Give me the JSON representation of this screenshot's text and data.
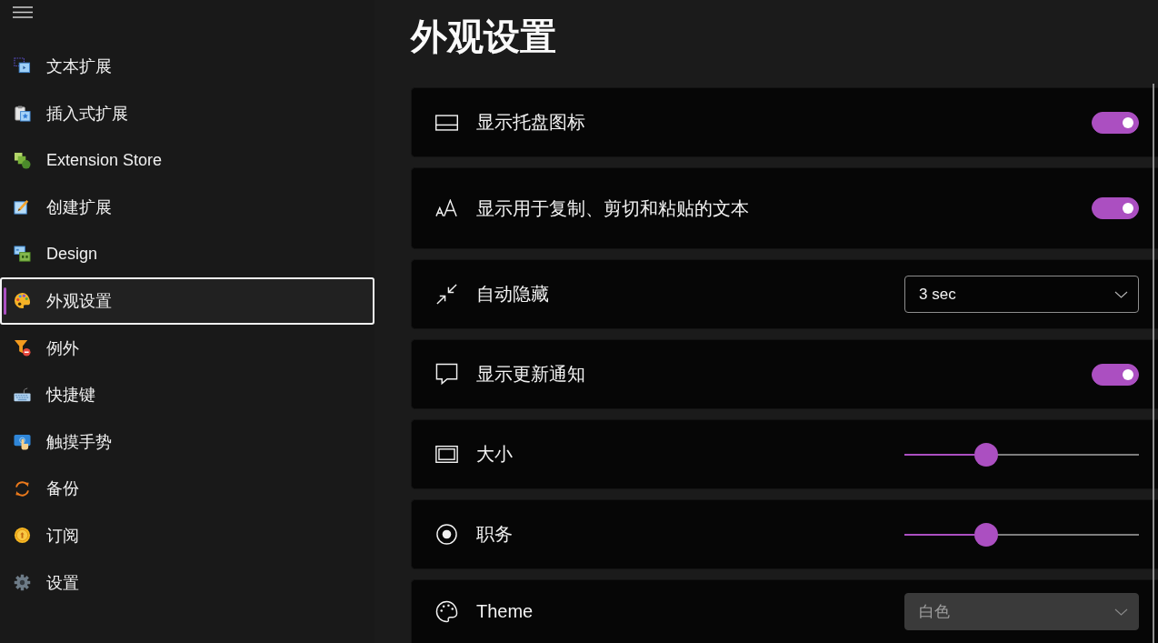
{
  "sidebar": {
    "items": [
      {
        "label": "文本扩展",
        "selected": false
      },
      {
        "label": "插入式扩展",
        "selected": false
      },
      {
        "label": "Extension Store",
        "selected": false
      },
      {
        "label": "创建扩展",
        "selected": false
      },
      {
        "label": "Design",
        "selected": false
      },
      {
        "label": "外观设置",
        "selected": true
      },
      {
        "label": "例外",
        "selected": false
      },
      {
        "label": "快捷键",
        "selected": false
      },
      {
        "label": "触摸手势",
        "selected": false
      },
      {
        "label": "备份",
        "selected": false
      },
      {
        "label": "订阅",
        "selected": false
      },
      {
        "label": "设置",
        "selected": false
      }
    ]
  },
  "page": {
    "title": "外观设置"
  },
  "settings": [
    {
      "kind": "toggle",
      "label": "显示托盘图标",
      "on": true
    },
    {
      "kind": "toggle",
      "label": "显示用于复制、剪切和粘贴的文本",
      "on": true
    },
    {
      "kind": "dropdown",
      "label": "自动隐藏",
      "value": "3 sec",
      "disabled": false
    },
    {
      "kind": "toggle",
      "label": "显示更新通知",
      "on": true
    },
    {
      "kind": "slider",
      "label": "大小",
      "level": 0.33
    },
    {
      "kind": "slider",
      "label": "职务",
      "level": 0.33
    },
    {
      "kind": "dropdown",
      "label": "Theme",
      "value": "白色",
      "disabled": true
    }
  ]
}
